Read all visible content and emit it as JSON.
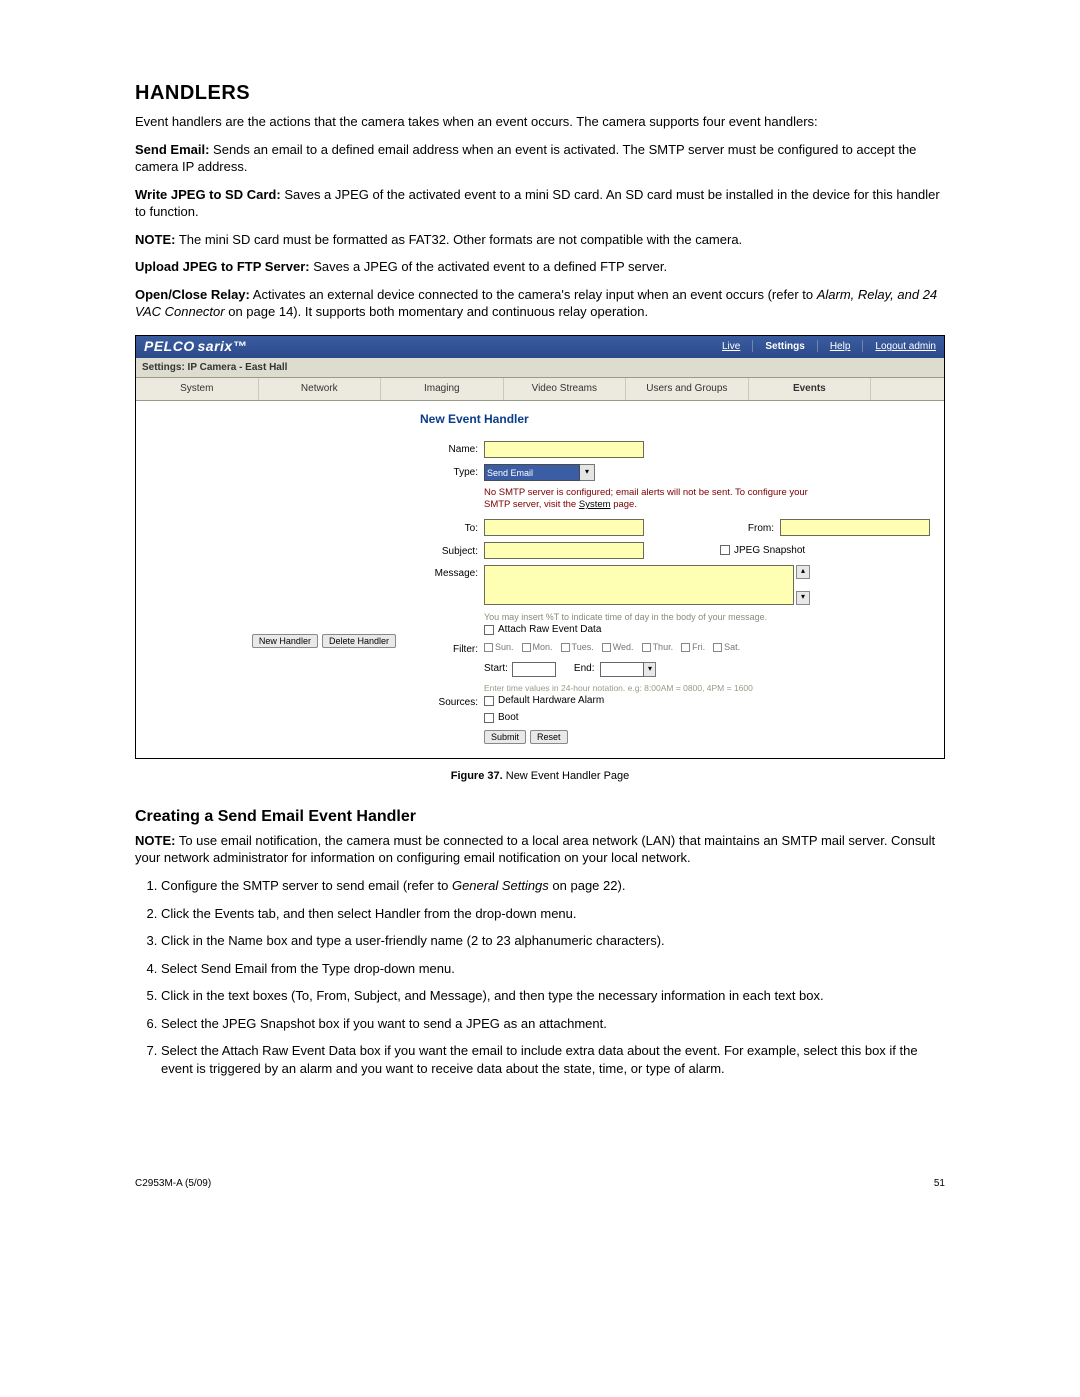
{
  "heading": "HANDLERS",
  "intro": "Event handlers are the actions that the camera takes when an event occurs. The camera supports four event handlers:",
  "bullets": {
    "sendEmail": {
      "label": "Send Email:",
      "text": "Sends an email to a defined email address when an event is activated. The SMTP server must be configured to accept the camera IP address."
    },
    "writeJpeg": {
      "label": "Write JPEG to SD Card:",
      "text": "Saves a JPEG of the activated event to a mini SD card. An SD card must be installed in the device for this handler to function."
    },
    "note1": {
      "label": "NOTE:",
      "text": "The mini SD card must be formatted as FAT32. Other formats are not compatible with the camera."
    },
    "uploadFtp": {
      "label": "Upload JPEG to FTP Server:",
      "text": "Saves a JPEG of the activated event to a defined FTP server."
    },
    "relay": {
      "label": "Open/Close Relay:",
      "text1": "Activates an external device connected to the camera's relay input when an event occurs (refer to ",
      "italic": "Alarm, Relay, and 24 VAC Connector",
      "text2": " on page 14). It supports both momentary and continuous relay operation."
    }
  },
  "screenshot": {
    "brand": "PELCO",
    "brandSub": "sarix™",
    "topLinks": {
      "live": "Live",
      "settings": "Settings",
      "help": "Help",
      "logout": "Logout admin"
    },
    "settingsRow": "Settings: IP Camera - East Hall",
    "tabs": [
      "System",
      "Network",
      "Imaging",
      "Video Streams",
      "Users and Groups",
      "Events",
      ""
    ],
    "formTitle": "New Event Handler",
    "labels": {
      "name": "Name:",
      "type": "Type:",
      "to": "To:",
      "from": "From:",
      "subject": "Subject:",
      "jpegSnapshot": "JPEG Snapshot",
      "message": "Message:",
      "filter": "Filter:",
      "sources": "Sources:"
    },
    "typeValue": "Send Email",
    "warning": {
      "t1": "No SMTP server is configured; email alerts will not be sent. To configure your SMTP server, visit the ",
      "link": "System",
      "t2": " page."
    },
    "msgHint": "You may insert %T to indicate time of day in the body of your message.",
    "attachRaw": "Attach Raw Event Data",
    "days": [
      "Sun.",
      "Mon.",
      "Tues.",
      "Wed.",
      "Thur.",
      "Fri.",
      "Sat."
    ],
    "startLabel": "Start:",
    "endLabel": "End:",
    "timeHint": "Enter time values in 24-hour notation. e.g: 8:00AM = 0800, 4PM = 1600",
    "sources": [
      "Default Hardware Alarm",
      "Boot"
    ],
    "leftButtons": {
      "new": "New Handler",
      "delete": "Delete Handler"
    },
    "submit": "Submit",
    "reset": "Reset"
  },
  "figureCaption": {
    "label": "Figure 37.",
    "text": "New Event Handler Page"
  },
  "subheading": "Creating a Send Email Event Handler",
  "note2": {
    "label": "NOTE:",
    "text": "To use email notification, the camera must be connected to a local area network (LAN) that maintains an SMTP mail server. Consult your network administrator for information on configuring email notification on your local network."
  },
  "steps": [
    {
      "t1": "Configure the SMTP server to send email (refer to ",
      "it": "General Settings",
      "t2": " on page 22)."
    },
    {
      "t1": "Click the Events tab, and then select Handler from the drop-down menu."
    },
    {
      "t1": "Click in the Name box and type a user-friendly name (2 to 23 alphanumeric characters)."
    },
    {
      "t1": "Select Send Email from the Type drop-down menu."
    },
    {
      "t1": "Click in the text boxes (To, From, Subject, and Message), and then type the necessary information in each text box."
    },
    {
      "t1": "Select the JPEG Snapshot box if you want to send a JPEG as an attachment."
    },
    {
      "t1": "Select the Attach Raw Event Data box if you want the email to include extra data about the event. For example, select this box if the event is triggered by an alarm and you want to receive data about the state, time, or type of alarm."
    }
  ],
  "footer": {
    "left": "C2953M-A (5/09)",
    "right": "51"
  }
}
